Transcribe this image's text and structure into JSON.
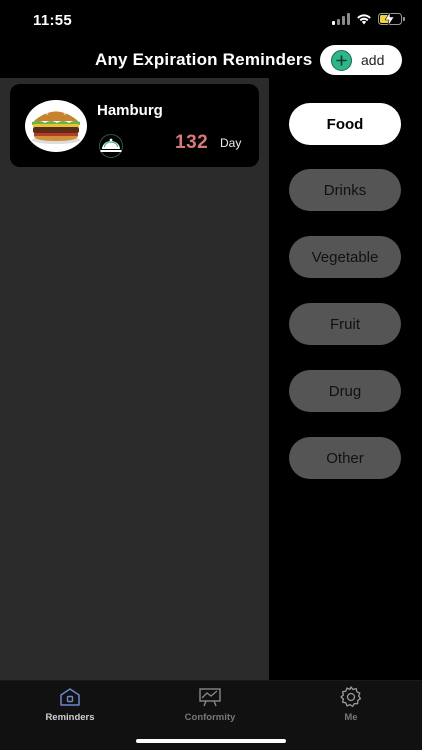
{
  "status_bar": {
    "time": "11:55"
  },
  "header": {
    "title": "Any Expiration Reminders",
    "add_label": "add"
  },
  "reminders": [
    {
      "name": "Hamburg",
      "days": "132",
      "unit": "Day",
      "category_icon": "cloche-icon",
      "days_color": "#d9787a"
    }
  ],
  "categories": [
    {
      "label": "Food",
      "active": true
    },
    {
      "label": "Drinks",
      "active": false
    },
    {
      "label": "Vegetable",
      "active": false
    },
    {
      "label": "Fruit",
      "active": false
    },
    {
      "label": "Drug",
      "active": false
    },
    {
      "label": "Other",
      "active": false
    }
  ],
  "tabs": [
    {
      "label": "Reminders",
      "icon": "home-icon",
      "active": true
    },
    {
      "label": "Conformity",
      "icon": "chart-board-icon",
      "active": false
    },
    {
      "label": "Me",
      "icon": "gear-icon",
      "active": false
    }
  ],
  "colors": {
    "accent_add": "#2fb58a",
    "panel_bg": "#2b2b2b",
    "pill_inactive": "#555555"
  }
}
